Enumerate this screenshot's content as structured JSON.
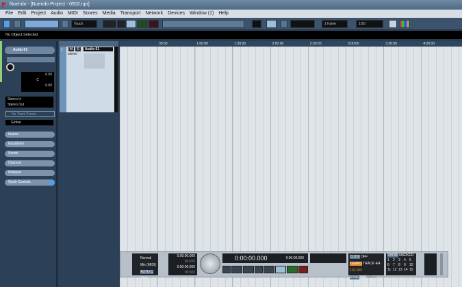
{
  "window": {
    "title": "Nuendo - [Nuendo Project - 0502.npr]"
  },
  "menu": [
    "File",
    "Edit",
    "Project",
    "Audio",
    "MIDI",
    "Scores",
    "Media",
    "Transport",
    "Network",
    "Devices",
    "Window (1)",
    "Help"
  ],
  "toolbar": {
    "automation_mode": "Touch",
    "grid_type": "1 frame",
    "quantize": "1/16"
  },
  "info_line": "No Object Selected",
  "inspector": {
    "track_name": "Audio 01",
    "volume": "0.00",
    "pan": "C",
    "delay": "0.00",
    "input": "Stereo In",
    "output": "Stereo Out",
    "preset": "No Track Preset",
    "global": "Global",
    "sections": [
      "Inserts",
      "Equalizers",
      "Sends",
      "Channel",
      "Notepad",
      "Quick Controls"
    ]
  },
  "track": {
    "number": "1",
    "name": "Audio 01",
    "type": "stereo",
    "mute": "M",
    "solo": "S"
  },
  "ruler": [
    "30:00",
    "1:00:00",
    "1:30:00",
    "2:00:00",
    "2:30:00",
    "3:00:00",
    "3:30:00",
    "4:00:00"
  ],
  "transport": {
    "mode1": "Normal",
    "mode2": "Mix (MIDI)",
    "autoq": "AUTO Q",
    "autoq_val": "OFF",
    "left_locator": "0:00:00.000",
    "right_locator": "0:00:00.000",
    "left_offset": "00:000",
    "right_offset": "00:000",
    "primary_time": "0:00:00.000",
    "secondary_time": "0:00:00.000",
    "click": "CLICK",
    "click_val": "OFF",
    "tempo": "TEMPO",
    "track_label": "TRACK",
    "signature": "4/4",
    "bpm": "120.000",
    "sync": "SYNC",
    "int": "INT",
    "offline": "Offline",
    "show": "SHOW",
    "marker": "MARKER",
    "markers": [
      "1",
      "2",
      "3",
      "4",
      "5",
      "6",
      "7",
      "8",
      "9",
      "10",
      "11",
      "12",
      "13",
      "14",
      "15"
    ]
  },
  "colors": {
    "accent": "#5a9de0",
    "tempo": "#e58a2c",
    "play": "#2a6b2a",
    "record": "#7a1d1d"
  }
}
